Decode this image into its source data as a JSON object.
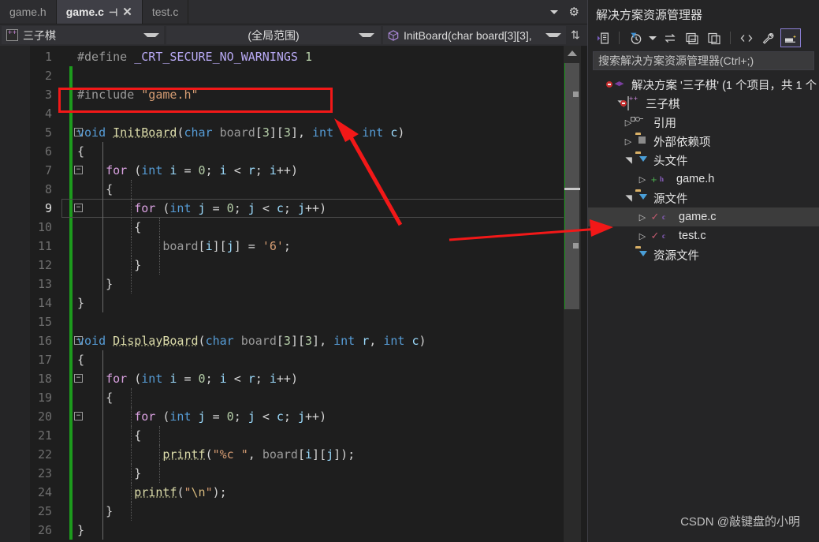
{
  "tabs": [
    {
      "label": "game.h",
      "active": false
    },
    {
      "label": "game.c",
      "active": true
    },
    {
      "label": "test.c",
      "active": false
    }
  ],
  "tab_controls": {
    "pin": "⊣",
    "close": "✕",
    "overflow_caret": "▾",
    "settings": "gear-icon"
  },
  "navbar": {
    "project": "三子棋",
    "scope": "(全局范围)",
    "member": "InitBoard(char board[3][3],"
  },
  "editor": {
    "lines": [
      {
        "n": 1,
        "text": "#define _CRT_SECURE_NO_WARNINGS 1"
      },
      {
        "n": 2,
        "text": ""
      },
      {
        "n": 3,
        "text": "#include \"game.h\""
      },
      {
        "n": 4,
        "text": ""
      },
      {
        "n": 5,
        "text": "void InitBoard(char board[3][3], int r, int c)"
      },
      {
        "n": 6,
        "text": "{"
      },
      {
        "n": 7,
        "text": "\tfor (int i = 0; i < r; i++)"
      },
      {
        "n": 8,
        "text": "\t{"
      },
      {
        "n": 9,
        "text": "\t\tfor (int j = 0; j < c; j++)"
      },
      {
        "n": 10,
        "text": "\t\t{"
      },
      {
        "n": 11,
        "text": "\t\t\tboard[i][j] = '6';"
      },
      {
        "n": 12,
        "text": "\t\t}"
      },
      {
        "n": 13,
        "text": "\t}"
      },
      {
        "n": 14,
        "text": "}"
      },
      {
        "n": 15,
        "text": ""
      },
      {
        "n": 16,
        "text": "void DisplayBoard(char board[3][3], int r, int c)"
      },
      {
        "n": 17,
        "text": "{"
      },
      {
        "n": 18,
        "text": "\tfor (int i = 0; i < r; i++)"
      },
      {
        "n": 19,
        "text": "\t{"
      },
      {
        "n": 20,
        "text": "\t\tfor (int j = 0; j < c; j++)"
      },
      {
        "n": 21,
        "text": "\t\t{"
      },
      {
        "n": 22,
        "text": "\t\t\tprintf(\"%c \", board[i][j]);"
      },
      {
        "n": 23,
        "text": "\t\t}"
      },
      {
        "n": 24,
        "text": "\t\tprintf(\"\\n\");"
      },
      {
        "n": 25,
        "text": "\t}"
      },
      {
        "n": 26,
        "text": "}"
      }
    ],
    "current_line": 9,
    "language": "C"
  },
  "solution_explorer": {
    "title": "解决方案资源管理器",
    "search_placeholder": "搜索解决方案资源管理器(Ctrl+;)",
    "toolbar": [
      "home-icon",
      "pending-changes-clock-icon",
      "sync-icon",
      "collapse-all-icon",
      "copy-icon",
      "show-all-files-icon",
      "properties-wrench-icon",
      "preview-selected-icon"
    ],
    "tree": [
      {
        "indent": 0,
        "twisty": "none",
        "icon": "solution-icon",
        "label": "解决方案 '三子棋' (1 个项目，共 1 个",
        "error_badge": true,
        "check": false,
        "plus": false,
        "selected": false
      },
      {
        "indent": 1,
        "twisty": "expanded",
        "icon": "cpp-project-icon",
        "label": "三子棋",
        "error_badge": true,
        "check": false,
        "plus": false,
        "selected": false
      },
      {
        "indent": 2,
        "twisty": "collapsed",
        "icon": "references-icon",
        "label": "引用",
        "error_badge": false,
        "check": false,
        "plus": false,
        "selected": false
      },
      {
        "indent": 2,
        "twisty": "collapsed",
        "icon": "ext-folder-icon",
        "label": "外部依赖项",
        "error_badge": false,
        "check": false,
        "plus": false,
        "selected": false
      },
      {
        "indent": 2,
        "twisty": "expanded",
        "icon": "filter-folder-icon",
        "label": "头文件",
        "error_badge": false,
        "check": false,
        "plus": false,
        "selected": false
      },
      {
        "indent": 3,
        "twisty": "collapsed",
        "icon": "h-file-icon",
        "label": "game.h",
        "error_badge": false,
        "check": false,
        "plus": true,
        "selected": false
      },
      {
        "indent": 2,
        "twisty": "expanded",
        "icon": "filter-folder-icon",
        "label": "源文件",
        "error_badge": false,
        "check": false,
        "plus": false,
        "selected": false
      },
      {
        "indent": 3,
        "twisty": "collapsed",
        "icon": "c-file-icon",
        "label": "game.c",
        "error_badge": false,
        "check": true,
        "plus": false,
        "selected": true
      },
      {
        "indent": 3,
        "twisty": "collapsed",
        "icon": "c-file-icon",
        "label": "test.c",
        "error_badge": false,
        "check": true,
        "plus": false,
        "selected": false
      },
      {
        "indent": 2,
        "twisty": "none",
        "icon": "filter-folder-icon",
        "label": "资源文件",
        "error_badge": false,
        "check": false,
        "plus": false,
        "selected": false
      }
    ]
  },
  "annotations": {
    "highlight_box_line": 3,
    "arrow_diagonal": "points from line 9 area up-left to the #include \"game.h\" red box",
    "arrow_horizontal": "points right from editor to game.c in Solution Explorer",
    "color": "#f21818"
  },
  "watermark": "CSDN @敲键盘的小明",
  "colors": {
    "editor_bg": "#1e1e1e",
    "chrome_bg": "#2d2d30",
    "panel_bg": "#252526",
    "accent_red": "#f21818",
    "change_bar_green": "#1d9b1d",
    "selection": "#3c3c3c"
  }
}
